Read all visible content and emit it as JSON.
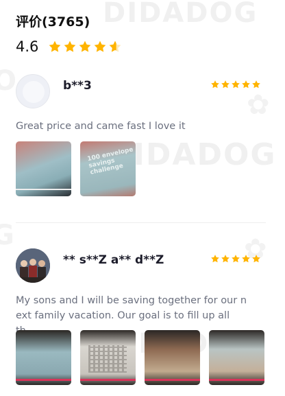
{
  "header": {
    "title": "评价(3765)",
    "rating": "4.6",
    "rating_stars": 4.6
  },
  "watermark": "DIDADOG",
  "reviews": [
    {
      "name": "b**3",
      "stars": 5,
      "text": "Great price and came fast I love it",
      "photo_count": 2,
      "photo_text": "100 envelope savings challenge"
    },
    {
      "name": "** s**Z a** d**Z",
      "stars": 5,
      "text_line1": "My sons and I will be saving together for our n",
      "text_line2": "ext family vacation. Our goal is to fill up all th...",
      "photo_count": 4
    }
  ],
  "colors": {
    "star": "#ffb400",
    "text_muted": "#6a6f7e",
    "accent_strip": "#d9345a"
  }
}
